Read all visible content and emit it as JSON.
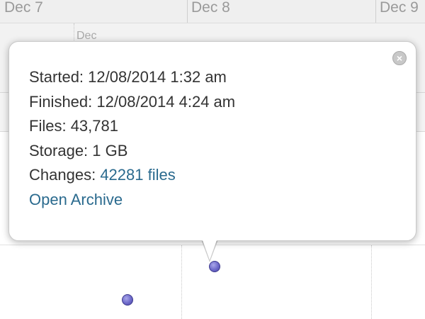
{
  "timeline": {
    "dates": [
      "Dec 7",
      "Dec 8",
      "Dec 9"
    ],
    "sub_date": "Dec"
  },
  "popover": {
    "started_label": "Started:",
    "started_value": "12/08/2014 1:32 am",
    "finished_label": "Finished:",
    "finished_value": "12/08/2014 4:24 am",
    "files_label": "Files:",
    "files_value": "43,781",
    "storage_label": "Storage:",
    "storage_value": "1 GB",
    "changes_label": "Changes:",
    "changes_link": "42281 files",
    "open_archive_link": "Open Archive",
    "close_icon": "close-icon"
  },
  "colors": {
    "link": "#2a6a8e",
    "dot": "#6d69c9"
  }
}
